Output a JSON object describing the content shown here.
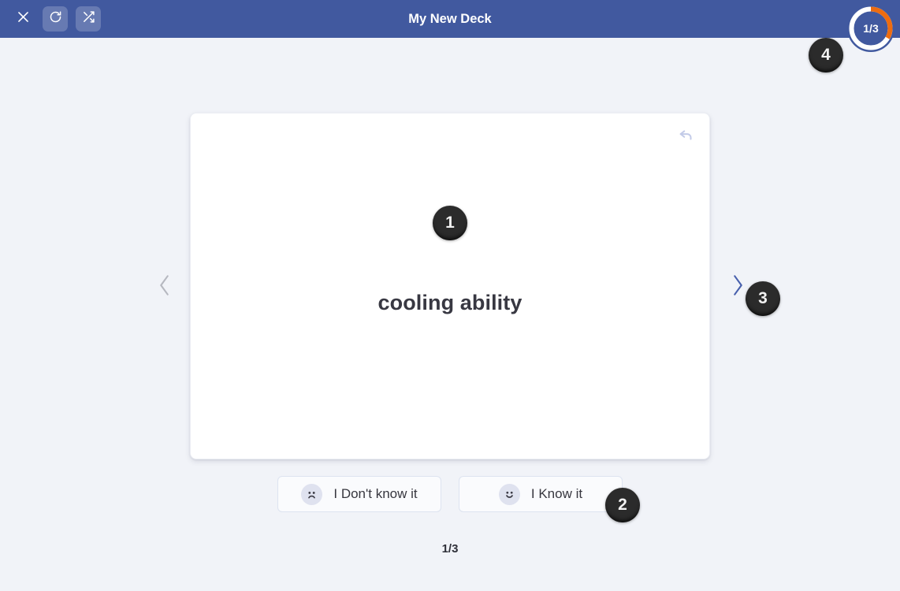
{
  "header": {
    "title": "My New Deck",
    "close_icon": "close-icon",
    "restart_icon": "restart-icon",
    "shuffle_icon": "shuffle-icon"
  },
  "progress": {
    "label": "1/3",
    "current": 1,
    "total": 3,
    "percent": 33,
    "track_color": "#ffffff",
    "arc_color": "#ed6c10",
    "inner_color": "#41599f"
  },
  "card": {
    "term": "cooling ability",
    "flip_icon": "undo-flip-icon",
    "background": "#ffffff"
  },
  "navigation": {
    "prev_icon": "chevron-left-icon",
    "next_icon": "chevron-right-icon",
    "prev_color": "#b6b8c0",
    "next_color": "#4860ad"
  },
  "answers": [
    {
      "label": "I Don't know it",
      "icon": "sad-face-icon",
      "mood": "sad"
    },
    {
      "label": "I Know it",
      "icon": "happy-face-icon",
      "mood": "happy"
    }
  ],
  "counter": {
    "label": "1/3"
  },
  "badges": [
    {
      "label": "1"
    },
    {
      "label": "2"
    },
    {
      "label": "3"
    },
    {
      "label": "4"
    }
  ],
  "colors": {
    "header_blue": "#41599f",
    "page_background": "#f1f3f8",
    "accent_orange": "#ed6c10",
    "badge_dark": "#2b2b2b"
  }
}
